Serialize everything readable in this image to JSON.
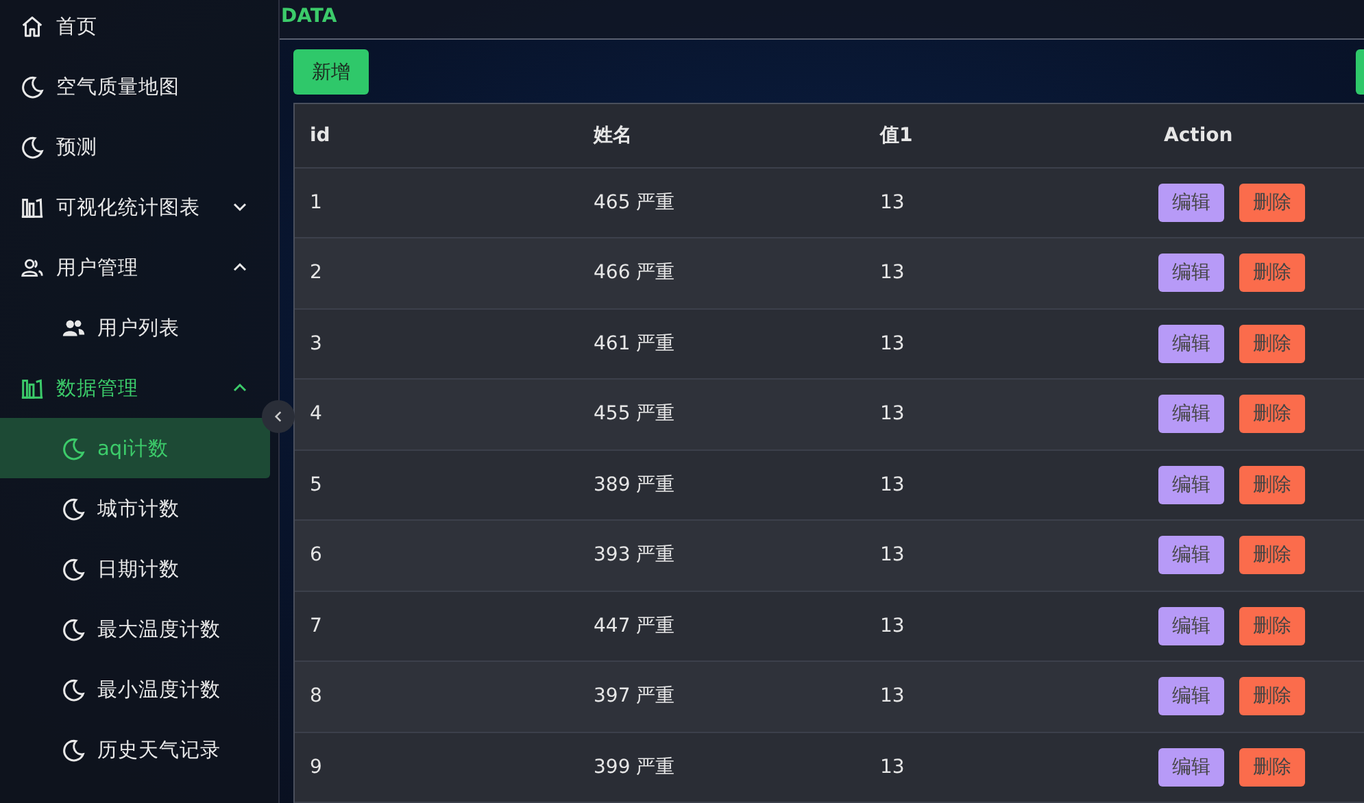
{
  "sidebar": {
    "items": [
      {
        "label": "首页",
        "kind": "home",
        "selected": false
      },
      {
        "label": "空气质量地图",
        "kind": "moon",
        "selected": false
      },
      {
        "label": "预测",
        "kind": "moon",
        "selected": false
      },
      {
        "label": "可视化统计图表",
        "kind": "chart",
        "selected": false,
        "expanded": false
      },
      {
        "label": "用户管理",
        "kind": "users",
        "selected": false,
        "expanded": true,
        "children": [
          {
            "label": "用户列表",
            "kind": "user-list",
            "selected": false
          }
        ]
      },
      {
        "label": "数据管理",
        "kind": "chart",
        "selected": true,
        "expanded": true,
        "children": [
          {
            "label": "aqi计数",
            "kind": "moon",
            "selected": true
          },
          {
            "label": "城市计数",
            "kind": "moon",
            "selected": false
          },
          {
            "label": "日期计数",
            "kind": "moon",
            "selected": false
          },
          {
            "label": "最大温度计数",
            "kind": "moon",
            "selected": false
          },
          {
            "label": "最小温度计数",
            "kind": "moon",
            "selected": false
          },
          {
            "label": "历史天气记录",
            "kind": "moon",
            "selected": false
          }
        ]
      }
    ]
  },
  "header": {
    "title": "DATA"
  },
  "toolbar": {
    "add_button": "新增"
  },
  "table": {
    "columns": [
      "id",
      "姓名",
      "值1",
      "Action"
    ],
    "rows": [
      {
        "id": "1",
        "name": "465 严重",
        "value1": "13",
        "actions": [
          "编辑",
          "删除"
        ]
      },
      {
        "id": "2",
        "name": "466 严重",
        "value1": "13",
        "actions": [
          "编辑",
          "删除"
        ]
      },
      {
        "id": "3",
        "name": "461 严重",
        "value1": "13",
        "actions": [
          "编辑",
          "删除"
        ]
      },
      {
        "id": "4",
        "name": "455 严重",
        "value1": "13",
        "actions": [
          "编辑",
          "删除"
        ]
      },
      {
        "id": "5",
        "name": "389 严重",
        "value1": "13",
        "actions": [
          "编辑",
          "删除"
        ]
      },
      {
        "id": "6",
        "name": "393 严重",
        "value1": "13",
        "actions": [
          "编辑",
          "删除"
        ]
      },
      {
        "id": "7",
        "name": "447 严重",
        "value1": "13",
        "actions": [
          "编辑",
          "删除"
        ]
      },
      {
        "id": "8",
        "name": "397 严重",
        "value1": "13",
        "actions": [
          "编辑",
          "删除"
        ]
      },
      {
        "id": "9",
        "name": "399 严重",
        "value1": "13",
        "actions": [
          "编辑",
          "删除"
        ]
      }
    ]
  }
}
